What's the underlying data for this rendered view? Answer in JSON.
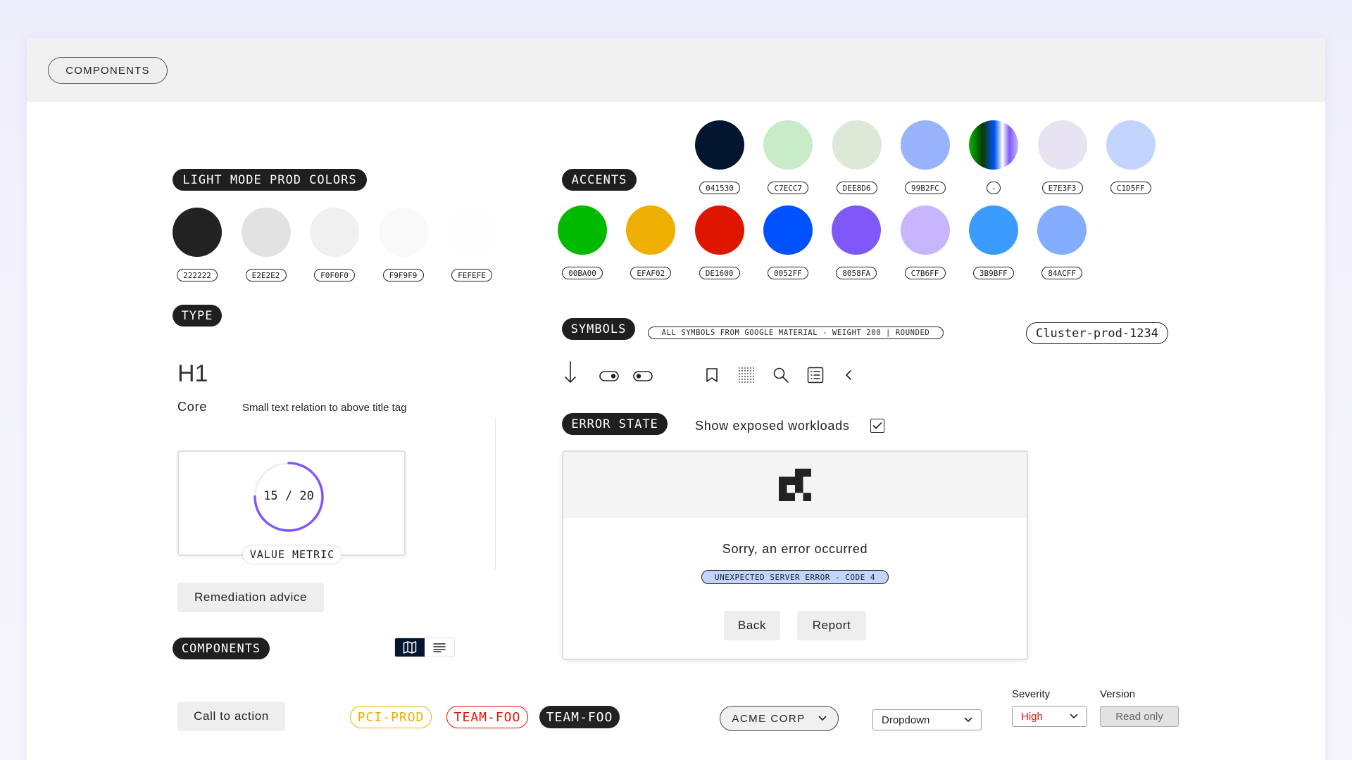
{
  "header": {
    "title": "COMPONENTS"
  },
  "light_mode": {
    "title": "LIGHT MODE PROD COLORS",
    "swatches": [
      {
        "hex": "222222",
        "color": "#222222"
      },
      {
        "hex": "E2E2E2",
        "color": "#E2E2E2"
      },
      {
        "hex": "F0F0F0",
        "color": "#F0F0F0"
      },
      {
        "hex": "F9F9F9",
        "color": "#F9F9F9"
      },
      {
        "hex": "FEFEFE",
        "color": "#FEFEFE"
      }
    ]
  },
  "accents": {
    "title": "ACCENTS",
    "row1": [
      {
        "hex": "041530",
        "color": "#041530"
      },
      {
        "hex": "C7ECC7",
        "color": "#C7ECC7"
      },
      {
        "hex": "DEE8D6",
        "color": "#DEE8D6"
      },
      {
        "hex": "99B2FC",
        "color": "#99B2FC"
      },
      {
        "hex": "-",
        "color": "gradient"
      },
      {
        "hex": "E7E3F3",
        "color": "#E7E3F3"
      },
      {
        "hex": "C1D5FF",
        "color": "#C1D5FF"
      }
    ],
    "row2": [
      {
        "hex": "00BA00",
        "color": "#00BA00"
      },
      {
        "hex": "EFAF02",
        "color": "#EFAF02"
      },
      {
        "hex": "DE1600",
        "color": "#DE1600"
      },
      {
        "hex": "0052FF",
        "color": "#0052FF"
      },
      {
        "hex": "8058FA",
        "color": "#8058FA"
      },
      {
        "hex": "C7B6FF",
        "color": "#C7B6FF"
      },
      {
        "hex": "3B9BFF",
        "color": "#3B9BFF"
      },
      {
        "hex": "84ACFF",
        "color": "#84ACFF"
      }
    ]
  },
  "type": {
    "title": "TYPE",
    "h1": "H1",
    "core": "Core",
    "small": "Small text relation to above title tag"
  },
  "symbols": {
    "title": "SYMBOLS",
    "note": "ALL SYMBOLS FROM GOOGLE MATERIAL - WEIGHT 200 | ROUNDED",
    "cluster": "Cluster-prod-1234",
    "icons": [
      "arrow-downward-icon",
      "toggle-on-icon",
      "toggle-off-icon",
      "bookmark-icon",
      "grid-icon",
      "search-icon",
      "list-icon",
      "chevron-left-icon"
    ]
  },
  "metric": {
    "value": 15,
    "total": 20,
    "separator": "/",
    "label": "VALUE METRIC",
    "ring_color": "#8058FA"
  },
  "remediation": {
    "label": "Remediation advice"
  },
  "error_state": {
    "title": "ERROR STATE",
    "checkbox_label": "Show exposed workloads",
    "checked": true,
    "message": "Sorry, an error occurred",
    "code": "UNEXPECTED SERVER ERROR - CODE 4",
    "back": "Back",
    "report": "Report"
  },
  "components": {
    "title": "COMPONENTS",
    "cta": "Call to action",
    "labels": [
      {
        "text": "PCI-PROD",
        "color": "#EFAF02",
        "style": "outline"
      },
      {
        "text": "TEAM-FOO",
        "color": "#DE1600",
        "style": "outline"
      },
      {
        "text": "TEAM-FOO",
        "color": "#222222",
        "style": "filled"
      }
    ],
    "org_select": "ACME CORP",
    "dropdown": "Dropdown",
    "severity": {
      "label": "Severity",
      "value": "High",
      "color": "#DE1600"
    },
    "version": {
      "label": "Version",
      "value": "Read only"
    }
  }
}
